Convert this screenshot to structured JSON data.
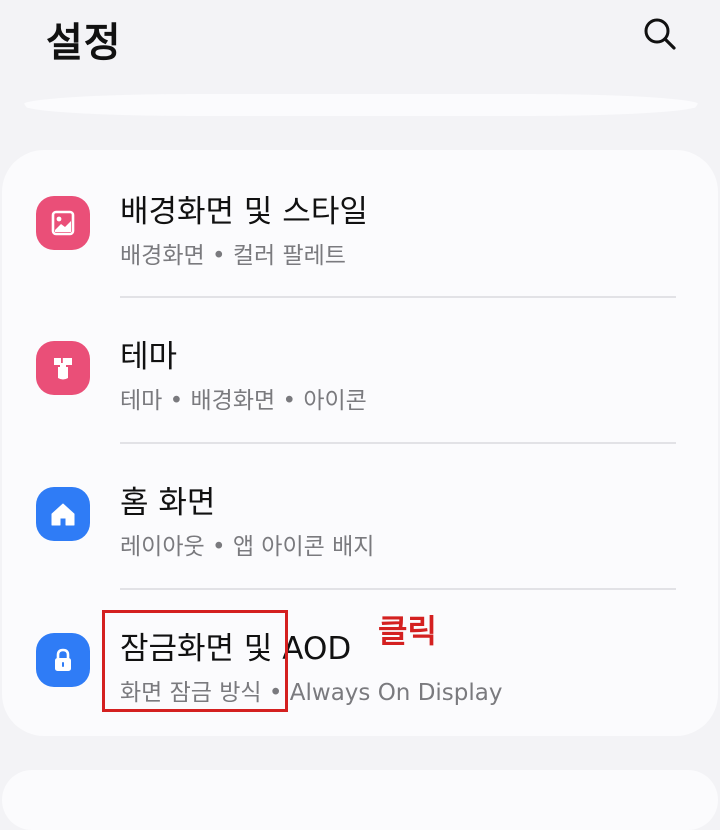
{
  "header": {
    "title": "설정"
  },
  "colors": {
    "pink_icon": "#ea4f78",
    "blue_icon": "#2f7cf6",
    "annotation": "#d42020",
    "background": "#f3f3f6",
    "card": "#fbfbfd"
  },
  "settings": {
    "items": [
      {
        "title": "배경화면 및 스타일",
        "subtitle": "배경화면  •  컬러 팔레트",
        "icon": "wallpaper-icon"
      },
      {
        "title": "테마",
        "subtitle": "테마  •  배경화면  •  아이콘",
        "icon": "theme-brush-icon"
      },
      {
        "title": "홈 화면",
        "subtitle": "레이아웃  •  앱 아이콘 배지",
        "icon": "home-icon"
      },
      {
        "title": "잠금화면 및 AOD",
        "subtitle": "화면 잠금 방식  •  Always On Display",
        "icon": "lock-icon"
      }
    ]
  },
  "annotation": {
    "label": "클릭"
  }
}
